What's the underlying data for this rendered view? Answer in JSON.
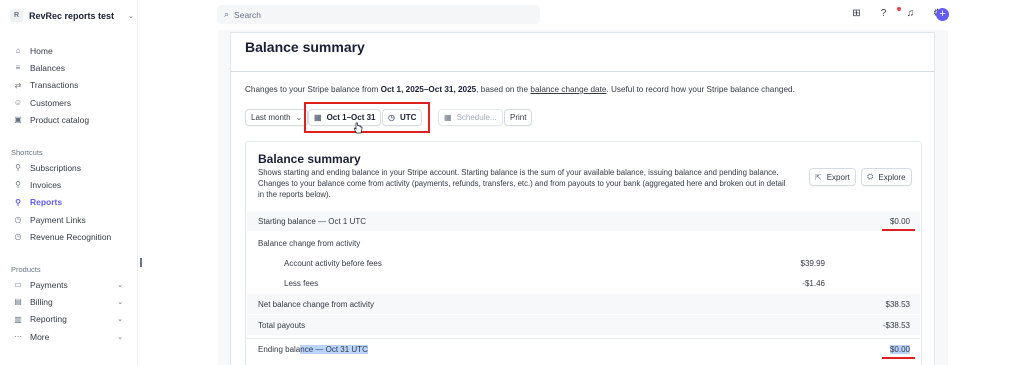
{
  "account": {
    "logo_letter": "R",
    "name": "RevRec reports test"
  },
  "nav": {
    "main": [
      {
        "label": "Home",
        "icon": "home-icon"
      },
      {
        "label": "Balances",
        "icon": "balances-icon"
      },
      {
        "label": "Transactions",
        "icon": "arrows-icon"
      },
      {
        "label": "Customers",
        "icon": "user-icon"
      },
      {
        "label": "Product catalog",
        "icon": "box-icon"
      }
    ],
    "shortcuts_label": "Shortcuts",
    "shortcuts": [
      {
        "label": "Subscriptions",
        "icon": "pin-icon"
      },
      {
        "label": "Invoices",
        "icon": "pin-icon"
      },
      {
        "label": "Reports",
        "icon": "pin-icon",
        "active": true
      },
      {
        "label": "Payment Links",
        "icon": "clock-icon"
      },
      {
        "label": "Revenue Recognition",
        "icon": "clock-icon"
      }
    ],
    "products_label": "Products",
    "products": [
      {
        "label": "Payments",
        "icon": "payments-icon"
      },
      {
        "label": "Billing",
        "icon": "billing-icon"
      },
      {
        "label": "Reporting",
        "icon": "chart-icon"
      },
      {
        "label": "More",
        "icon": "dots-icon"
      }
    ]
  },
  "search": {
    "placeholder": "Search"
  },
  "page": {
    "title": "Balance summary",
    "desc_pre": "Changes to your Stripe balance from ",
    "desc_range": "Oct 1, 2025–Oct 31, 2025",
    "desc_mid": ", based on the ",
    "desc_link": "balance change date",
    "desc_post": ". Useful to record how your Stripe balance changed."
  },
  "filters": {
    "period": "Last month",
    "date_range": "Oct 1–Oct 31",
    "timezone": "UTC",
    "schedule": "Schedule...",
    "print": "Print"
  },
  "report": {
    "title": "Balance summary",
    "description": "Shows starting and ending balance in your Stripe account. Starting balance is the sum of your available balance, issuing balance and pending balance. Changes to your balance come from activity (payments, refunds, transfers, etc.) and from payouts to your bank (aggregated here and broken out in detail in the reports below).",
    "export_label": "Export",
    "explore_label": "Explore",
    "rows": {
      "starting_label": "Starting balance — Oct 1 UTC",
      "starting_value": "$0.00",
      "change_label": "Balance change from activity",
      "activity_label": "Account activity before fees",
      "activity_value": "$39.99",
      "fees_label": "Less fees",
      "fees_value": "-$1.46",
      "net_label": "Net balance change from activity",
      "net_value": "$38.53",
      "payouts_label": "Total payouts",
      "payouts_value": "-$38.53",
      "ending_label_pre": "Ending bala",
      "ending_label_sel": "nce — Oct 31 UTC",
      "ending_value": "$0.00"
    }
  },
  "colors": {
    "accent": "#635bff",
    "annotation_red": "#e02020"
  }
}
